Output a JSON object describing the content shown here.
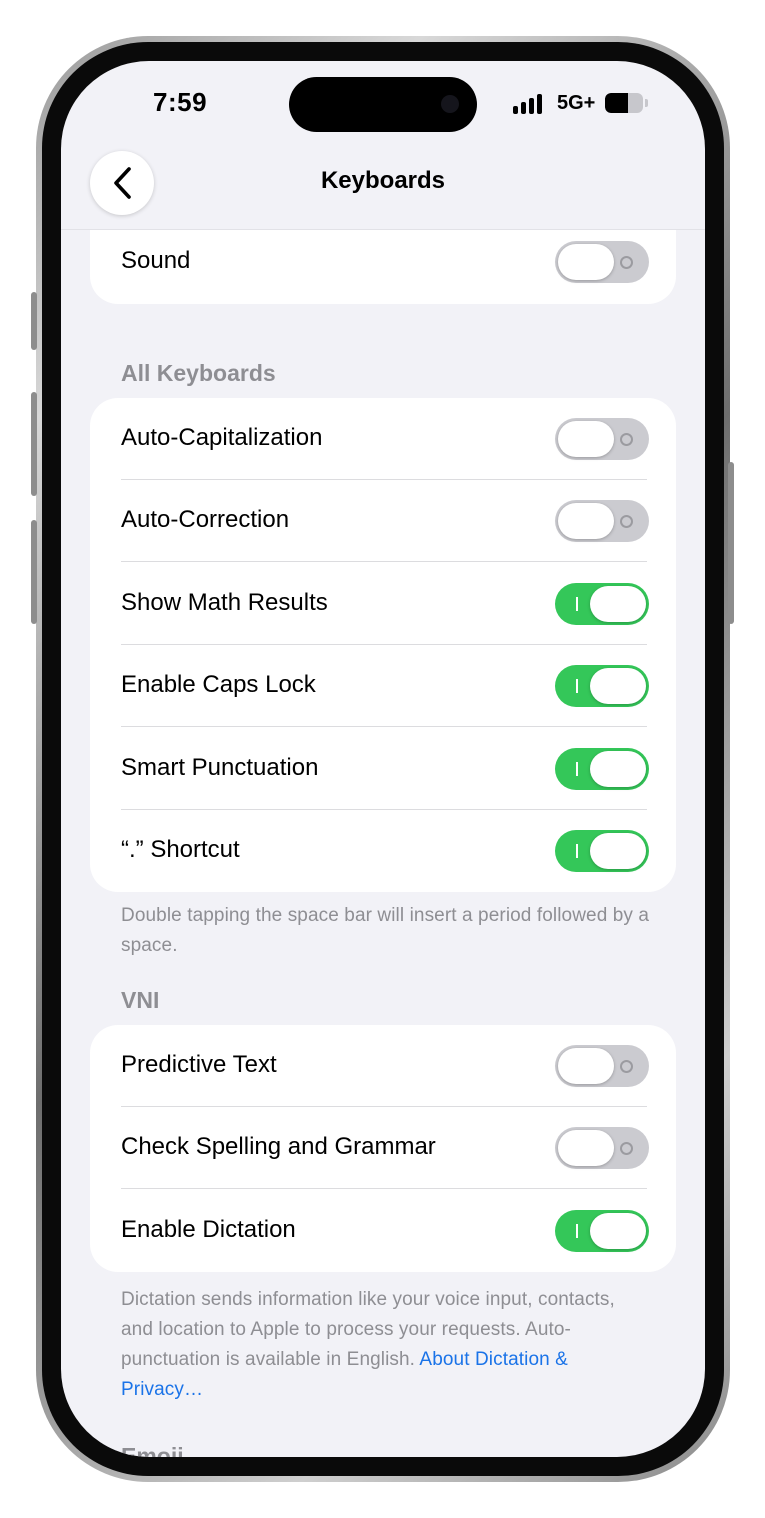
{
  "status_bar": {
    "time": "7:59",
    "network": "5G+",
    "battery_level": 0.6
  },
  "nav": {
    "title": "Keyboards"
  },
  "top_group": {
    "items": [
      {
        "label": "Sound",
        "on": false
      }
    ]
  },
  "all_keyboards": {
    "header": "All Keyboards",
    "items": [
      {
        "label": "Auto-Capitalization",
        "on": false
      },
      {
        "label": "Auto-Correction",
        "on": false
      },
      {
        "label": "Show Math Results",
        "on": true
      },
      {
        "label": "Enable Caps Lock",
        "on": true
      },
      {
        "label": "Smart Punctuation",
        "on": true
      },
      {
        "label": "“.” Shortcut",
        "on": true
      }
    ],
    "footer": "Double tapping the space bar will insert a period followed by a space."
  },
  "vni": {
    "header": "VNI",
    "items": [
      {
        "label": "Predictive Text",
        "on": false
      },
      {
        "label": "Check Spelling and Grammar",
        "on": false
      },
      {
        "label": "Enable Dictation",
        "on": true
      }
    ],
    "footer": "Dictation sends information like your voice input, contacts, and location to Apple to process your requests. Auto-punctuation is available in English.",
    "footer_link": "About Dictation & Privacy…"
  },
  "next_section": {
    "header": "Emoji"
  }
}
